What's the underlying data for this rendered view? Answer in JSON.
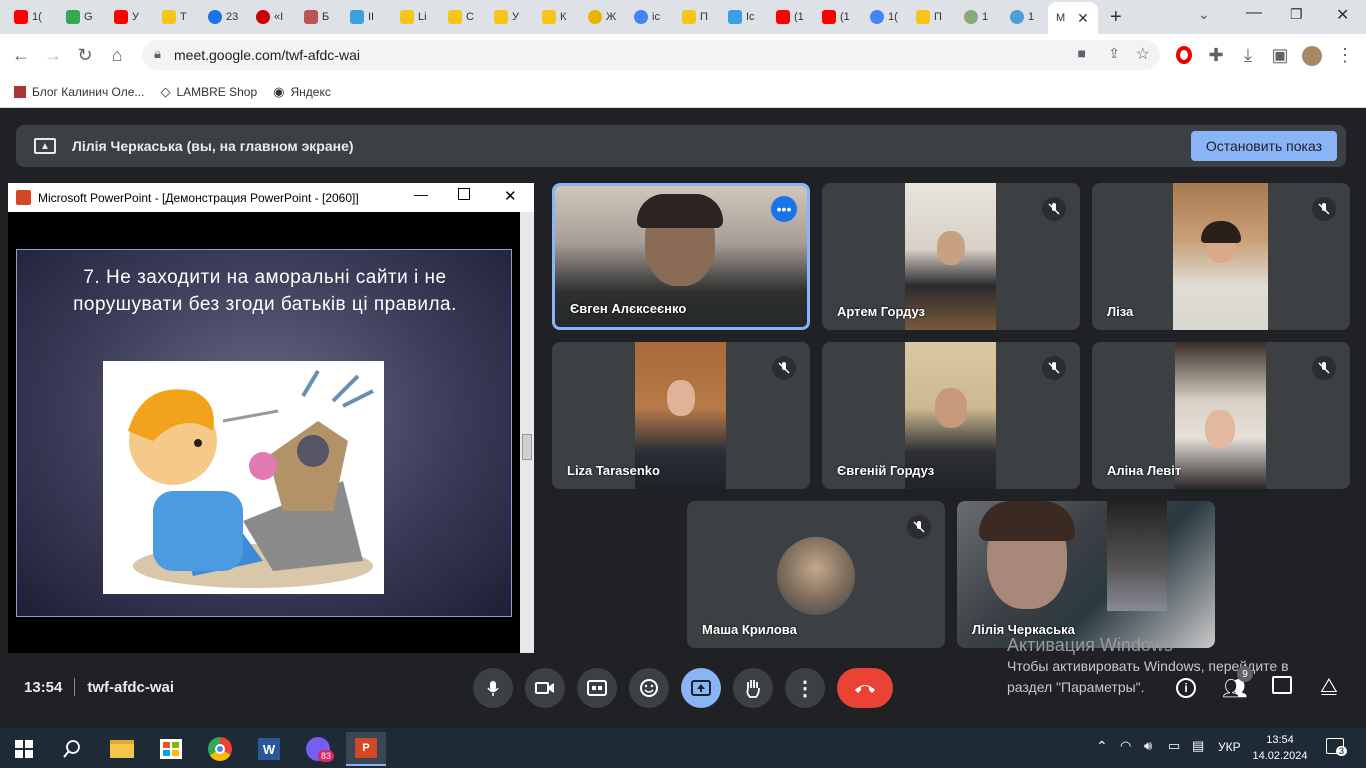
{
  "browser": {
    "tab_labels": [
      "1(",
      "G",
      "У",
      "Т",
      "23",
      "«I",
      "Б",
      "IІ",
      "Li",
      "С",
      "У",
      "К",
      "Ж",
      "ic",
      "П",
      "Ic",
      "(1",
      "(1",
      "1(",
      "П",
      "1",
      "1",
      "M"
    ],
    "url": "meet.google.com/twf-afdc-wai",
    "bookmarks": [
      "Блог Калинич Оле...",
      "LAMBRE Shop",
      "Яндекс"
    ]
  },
  "meet": {
    "banner_text": "Лілія Черкаська (вы, на главном экране)",
    "stop_button": "Остановить показ",
    "meeting_time": "13:54",
    "meeting_code": "twf-afdc-wai"
  },
  "ppt": {
    "window_title": "Microsoft PowerPoint - [Демонстрация PowerPoint - [2060]]",
    "slide_text": "7. Не заходити на аморальні сайти і не порушувати без згоди батьків ці правила."
  },
  "participants": [
    {
      "name": "Євген Алєксеєнко"
    },
    {
      "name": "Артем Гордуз"
    },
    {
      "name": "Ліза"
    },
    {
      "name": "Liza Tarasenko"
    },
    {
      "name": "Євгеній Гордуз"
    },
    {
      "name": "Аліна Левіт"
    },
    {
      "name": "Маша Крилова"
    },
    {
      "name": "Лілія Черкаська"
    }
  ],
  "watermark": {
    "line1": "Активация Windows",
    "line2": "Чтобы активировать Windows, перейдите в",
    "line3": "раздел \"Параметры\"."
  },
  "taskbar": {
    "lang": "УКР",
    "time": "13:54",
    "date": "14.02.2024",
    "notif_count": "3",
    "viber_badge": "83"
  },
  "colors": {
    "accent": "#8ab4f8",
    "end_call": "#ea4335",
    "present_active": "#8ab4f8"
  }
}
